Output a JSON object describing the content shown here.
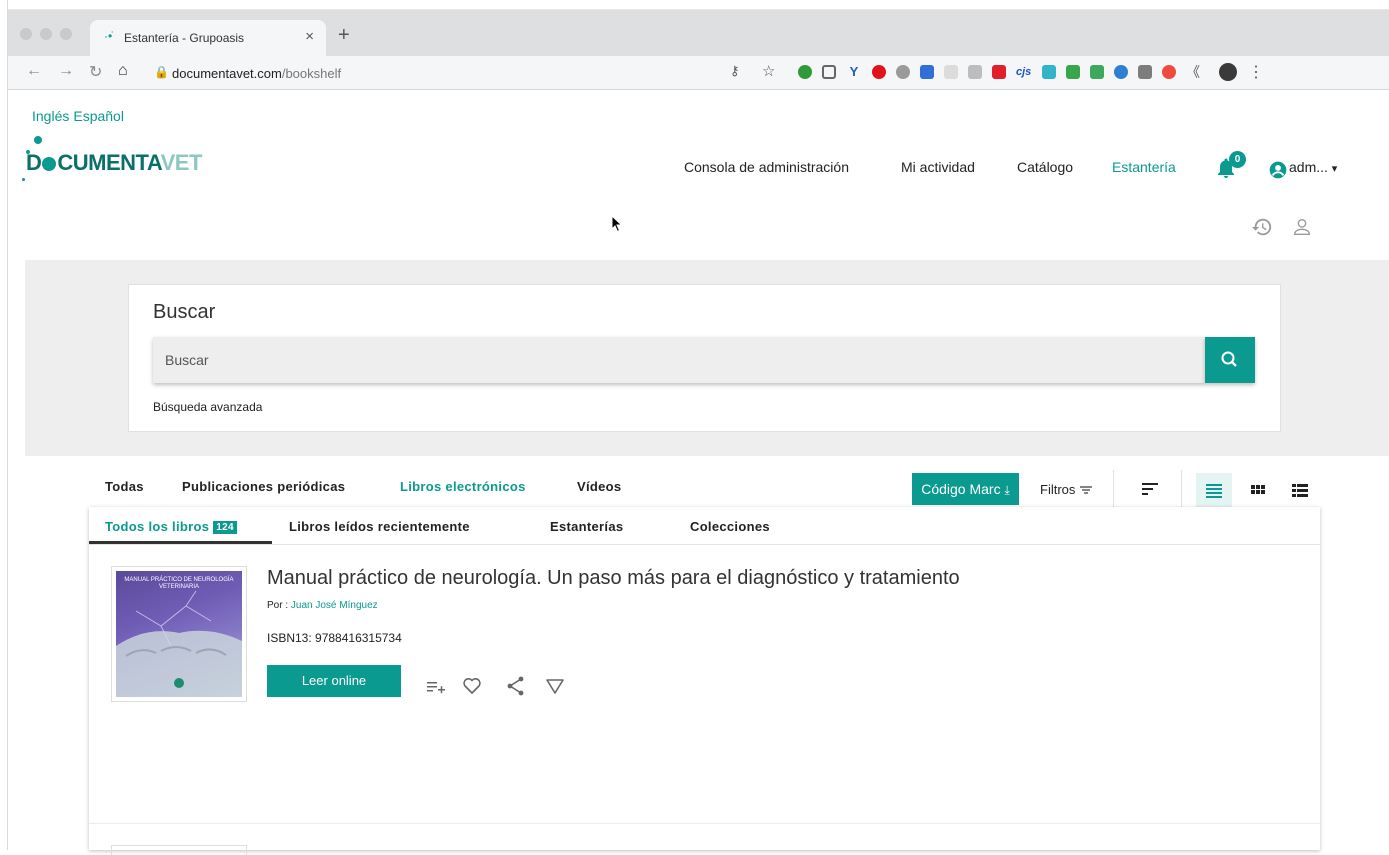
{
  "browser": {
    "tab_title": "Estantería - Grupoasis",
    "url_host": "documentavet.com",
    "url_path": "/bookshelf",
    "new_tab": "+",
    "close_tab": "×",
    "ext_cjs": "cjs"
  },
  "header": {
    "languages": [
      "Inglés",
      "Español"
    ],
    "logo": {
      "part1": "D",
      "part2": "CUMENTA",
      "part3": "VET"
    },
    "nav": [
      "Consola de administración",
      "Mi actividad",
      "Catálogo",
      "Estantería"
    ],
    "notifications_count": "0",
    "user_label": "adm...",
    "user_caret": "▾"
  },
  "search": {
    "title": "Buscar",
    "placeholder": "Buscar",
    "advanced_link": "Búsqueda avanzada"
  },
  "type_tabs": [
    "Todas",
    "Publicaciones periódicas",
    "Libros electrónicos",
    "Vídeos"
  ],
  "type_tabs_active": 2,
  "toolbar": {
    "marc_label": "Código Marc",
    "filters_label": "Filtros"
  },
  "shelf_tabs": {
    "all_books": "Todos los libros",
    "all_books_count": "124",
    "recent": "Libros leídos recientemente",
    "shelves": "Estanterías",
    "collections": "Colecciones"
  },
  "book": {
    "title": "Manual práctico de neurología. Un paso más para el diagnóstico y tratamiento",
    "author_prefix": "Por :",
    "author": "Juan José Mínguez",
    "isbn": "ISBN13: 9788416315734",
    "read_label": "Leer online",
    "cover_text": "MANUAL PRÁCTICO DE NEUROLOGÍA VETERINARIA"
  },
  "colors": {
    "accent": "#0a9a8f",
    "search_band": "#eeeeee"
  }
}
